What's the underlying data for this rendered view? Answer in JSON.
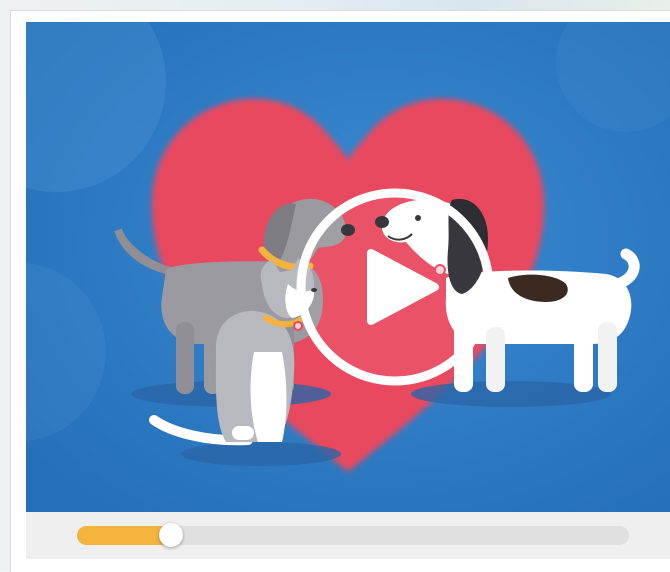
{
  "player": {
    "title": "",
    "progress_fraction": 0.17,
    "colors": {
      "background": "#2f7cc6",
      "heart": "#e8485f",
      "progress_fill": "#f3b33d",
      "progress_track": "#e0e0e0",
      "control_bar": "#efefef"
    },
    "play_icon": "play-icon"
  }
}
